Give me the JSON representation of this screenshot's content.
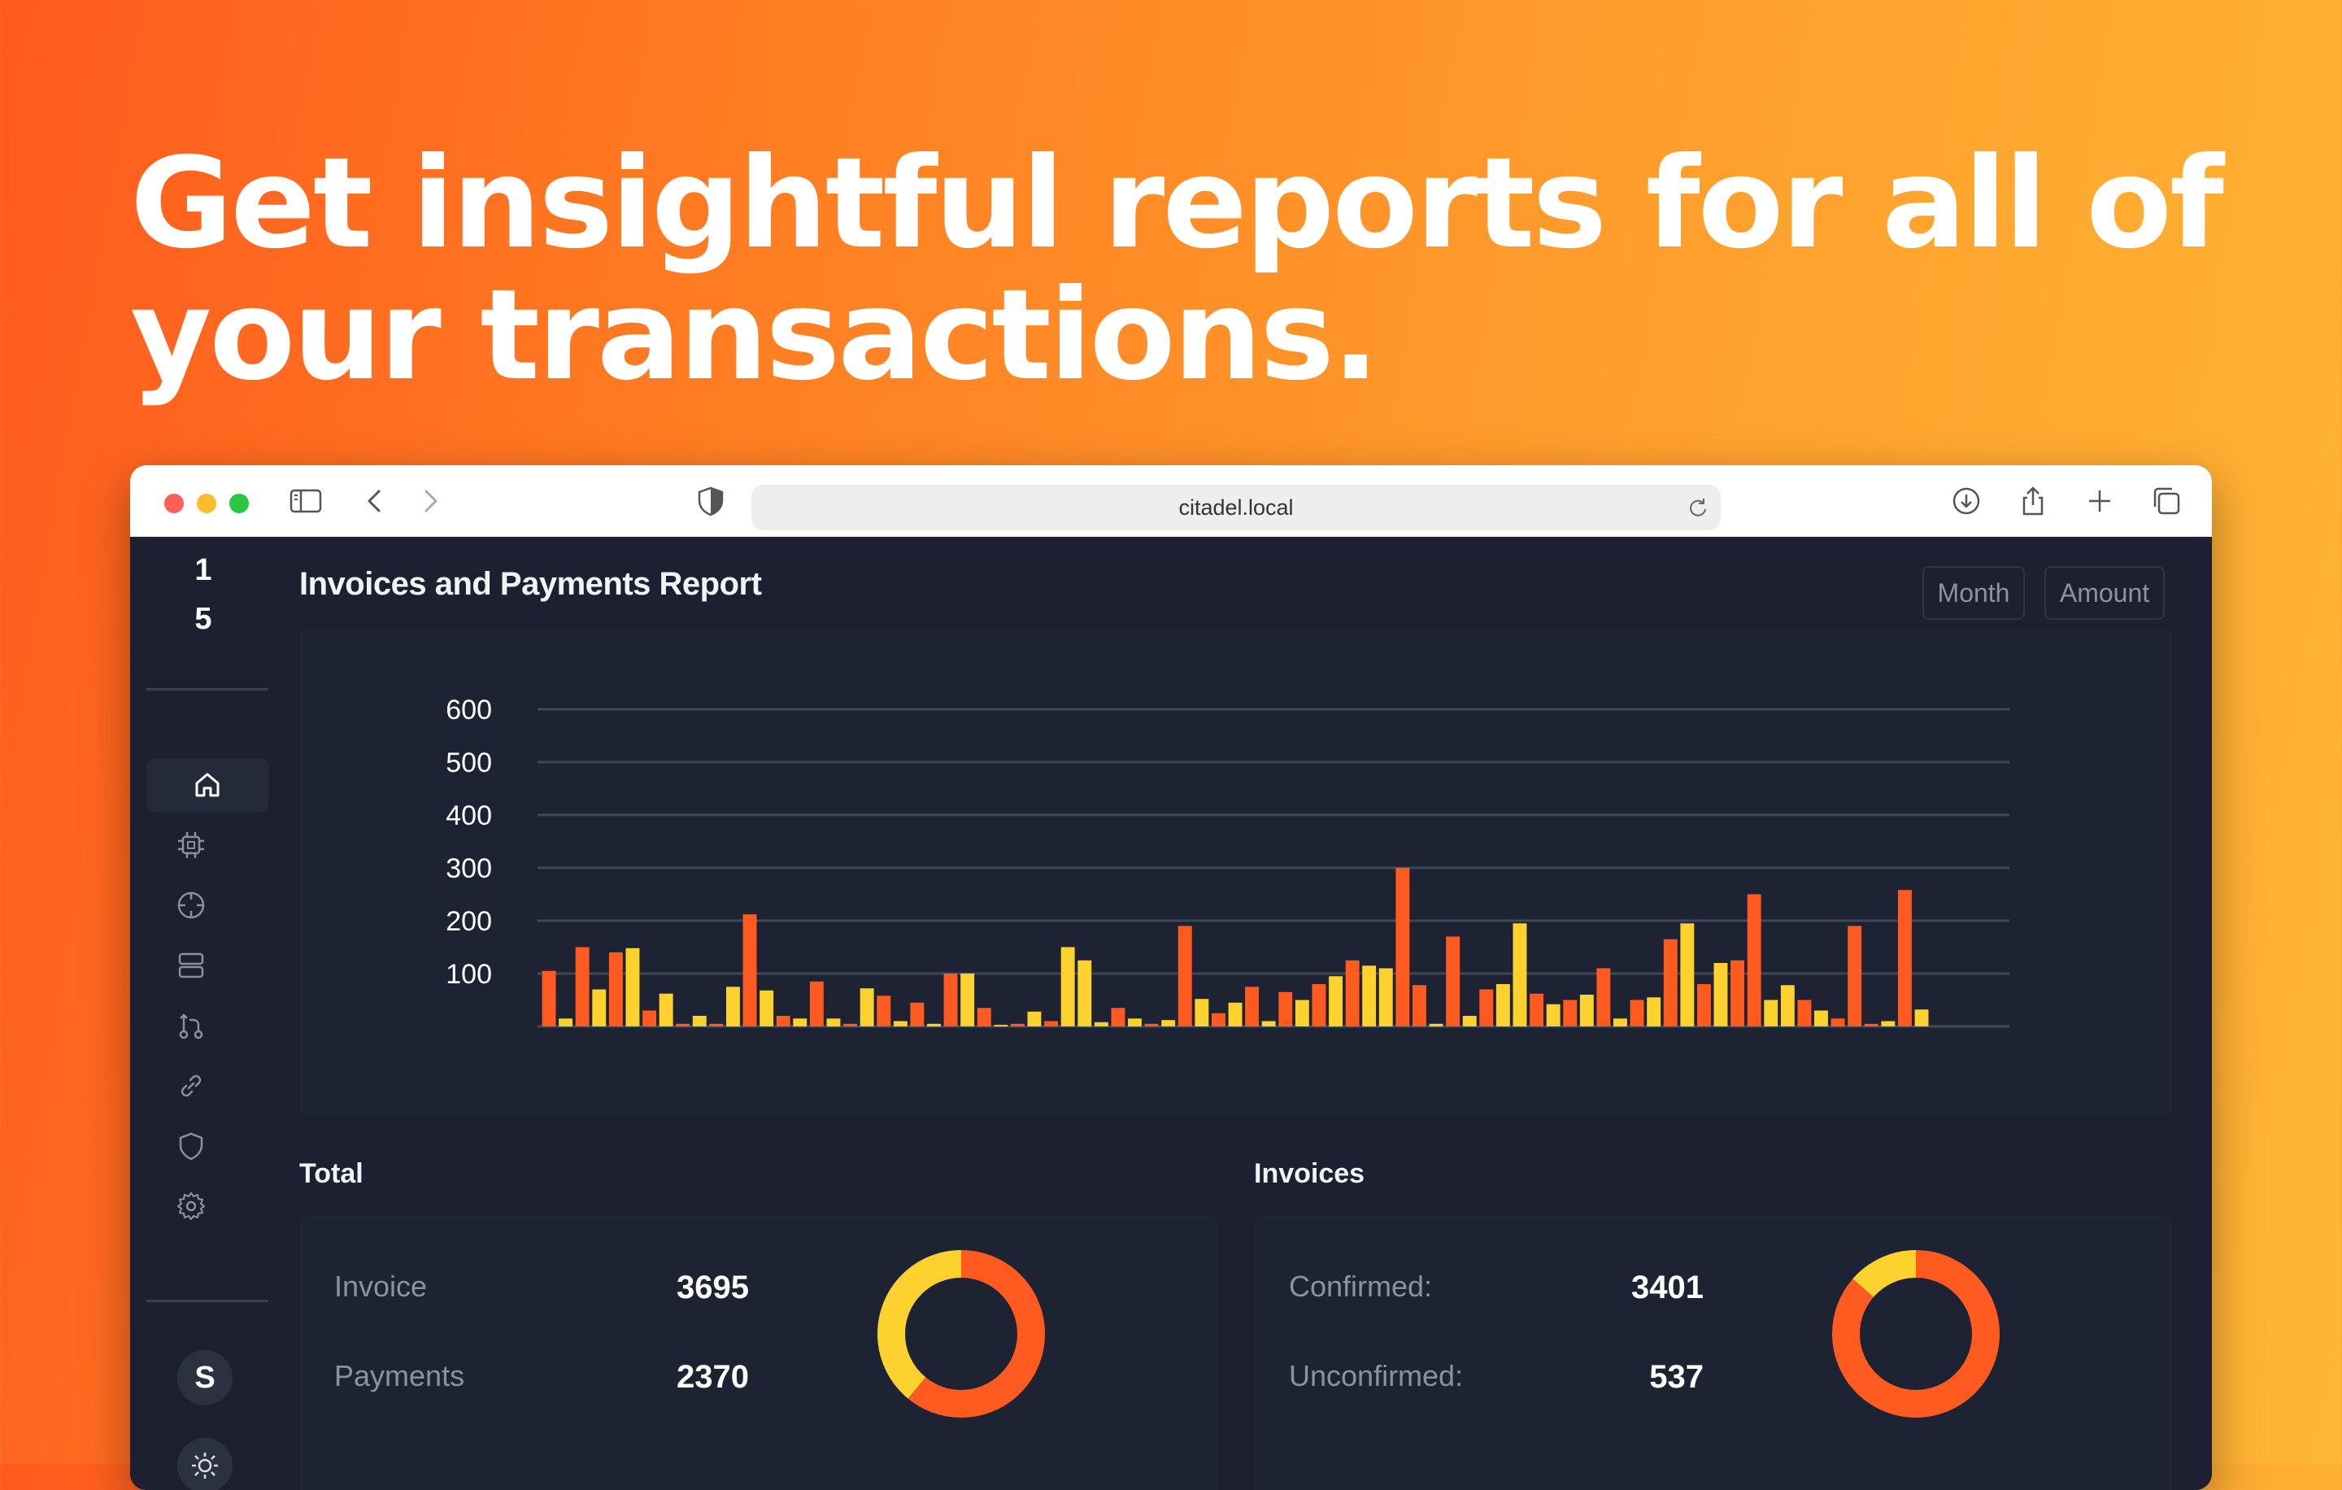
{
  "headline": {
    "line1": "Get insightful reports for all of",
    "line2": "your transactions."
  },
  "browser": {
    "url": "citadel.local",
    "icons": [
      "sidebar-toggle-icon",
      "back-arrow-icon",
      "forward-arrow-icon",
      "shield-privacy-icon",
      "reload-icon",
      "download-icon",
      "share-icon",
      "new-tab-plus-icon",
      "tabs-overview-icon"
    ]
  },
  "sidebar": {
    "numbers": [
      "1",
      "5"
    ],
    "icons": [
      "home-icon",
      "chip-icon",
      "crosshair-icon",
      "server-icon",
      "git-compare-icon",
      "link-icon",
      "shield-icon",
      "gear-icon"
    ],
    "active": "home-icon",
    "avatar_letter": "S",
    "theme_icon": "sun-icon"
  },
  "report": {
    "title": "Invoices and Payments Report",
    "buttons": {
      "month": "Month",
      "amount": "Amount"
    }
  },
  "chart_data": {
    "type": "bar",
    "title": "Invoices and Payments Report",
    "yticks": [
      100,
      200,
      300,
      400,
      500,
      600
    ],
    "ylim": [
      0,
      600
    ],
    "grid": true,
    "colors": {
      "invoice": "#ff5a1f",
      "payment": "#fdd22e"
    },
    "bars": [
      [
        "i",
        105
      ],
      [
        "p",
        15
      ],
      [
        "i",
        150
      ],
      [
        "p",
        70
      ],
      [
        "i",
        140
      ],
      [
        "p",
        148
      ],
      [
        "i",
        30
      ],
      [
        "p",
        62
      ],
      [
        "i",
        5
      ],
      [
        "p",
        20
      ],
      [
        "i",
        5
      ],
      [
        "p",
        75
      ],
      [
        "i",
        212
      ],
      [
        "p",
        68
      ],
      [
        "i",
        20
      ],
      [
        "p",
        15
      ],
      [
        "i",
        85
      ],
      [
        "p",
        15
      ],
      [
        "i",
        5
      ],
      [
        "p",
        72
      ],
      [
        "i",
        58
      ],
      [
        "p",
        10
      ],
      [
        "i",
        45
      ],
      [
        "p",
        5
      ],
      [
        "i",
        100
      ],
      [
        "p",
        100
      ],
      [
        "i",
        35
      ],
      [
        "p",
        3
      ],
      [
        "i",
        5
      ],
      [
        "p",
        28
      ],
      [
        "i",
        10
      ],
      [
        "p",
        150
      ],
      [
        "p",
        125
      ],
      [
        "p",
        8
      ],
      [
        "i",
        35
      ],
      [
        "p",
        15
      ],
      [
        "i",
        5
      ],
      [
        "p",
        12
      ],
      [
        "i",
        190
      ],
      [
        "p",
        52
      ],
      [
        "i",
        25
      ],
      [
        "p",
        45
      ],
      [
        "i",
        75
      ],
      [
        "p",
        10
      ],
      [
        "i",
        65
      ],
      [
        "p",
        50
      ],
      [
        "i",
        80
      ],
      [
        "p",
        95
      ],
      [
        "i",
        125
      ],
      [
        "p",
        115
      ],
      [
        "p",
        110
      ],
      [
        "i",
        300
      ],
      [
        "i",
        78
      ],
      [
        "p",
        5
      ],
      [
        "i",
        170
      ],
      [
        "p",
        20
      ],
      [
        "i",
        70
      ],
      [
        "p",
        80
      ],
      [
        "p",
        195
      ],
      [
        "i",
        62
      ],
      [
        "p",
        42
      ],
      [
        "i",
        50
      ],
      [
        "p",
        60
      ],
      [
        "i",
        110
      ],
      [
        "p",
        15
      ],
      [
        "i",
        50
      ],
      [
        "p",
        55
      ],
      [
        "i",
        165
      ],
      [
        "p",
        195
      ],
      [
        "i",
        80
      ],
      [
        "p",
        120
      ],
      [
        "i",
        125
      ],
      [
        "i",
        250
      ],
      [
        "p",
        50
      ],
      [
        "p",
        78
      ],
      [
        "i",
        50
      ],
      [
        "p",
        30
      ],
      [
        "i",
        15
      ],
      [
        "i",
        190
      ],
      [
        "i",
        5
      ],
      [
        "p",
        10
      ],
      [
        "i",
        258
      ],
      [
        "p",
        32
      ]
    ]
  },
  "total": {
    "title": "Total",
    "invoice_label": "Invoice",
    "invoice_value": "3695",
    "payments_label": "Payments",
    "payments_value": "2370",
    "donut": {
      "invoice": 3695,
      "payments": 2370
    }
  },
  "invoices": {
    "title": "Invoices",
    "confirmed_label": "Confirmed:",
    "confirmed_value": "3401",
    "unconfirmed_label": "Unconfirmed:",
    "unconfirmed_value": "537",
    "donut": {
      "confirmed": 3401,
      "unconfirmed": 537
    }
  }
}
